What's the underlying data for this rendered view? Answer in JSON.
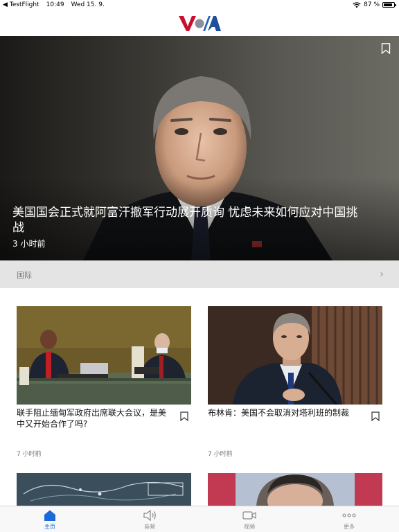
{
  "status_bar": {
    "back_app": "◀ TestFlight",
    "time": "10:49",
    "date": "Wed 15. 9.",
    "battery_text": "87 %",
    "battery_level": 0.87
  },
  "header": {
    "logo_text": "VOA"
  },
  "hero": {
    "title": "美国国会正式就阿富汗撤军行动展开质询 忧虑未来如何应对中国挑战",
    "time": "3 小时前"
  },
  "section": {
    "label": "国际"
  },
  "cards": [
    {
      "title": "联手阻止缅甸军政府出席联大会议，是美中又开始合作了吗?",
      "time": "7 小时前"
    },
    {
      "title": "布林肯：美国不会取消对塔利班的制裁",
      "time": "7 小时前"
    }
  ],
  "tabs": [
    {
      "label": "主页",
      "icon": "home-icon",
      "active": true
    },
    {
      "label": "音频",
      "icon": "speaker-icon",
      "active": false
    },
    {
      "label": "视频",
      "icon": "video-camera-icon",
      "active": false
    },
    {
      "label": "更多",
      "icon": "more-icon",
      "active": false
    }
  ],
  "colors": {
    "accent": "#1a6bd8",
    "logo_red": "#c8102e",
    "logo_blue": "#1f4e9c"
  }
}
